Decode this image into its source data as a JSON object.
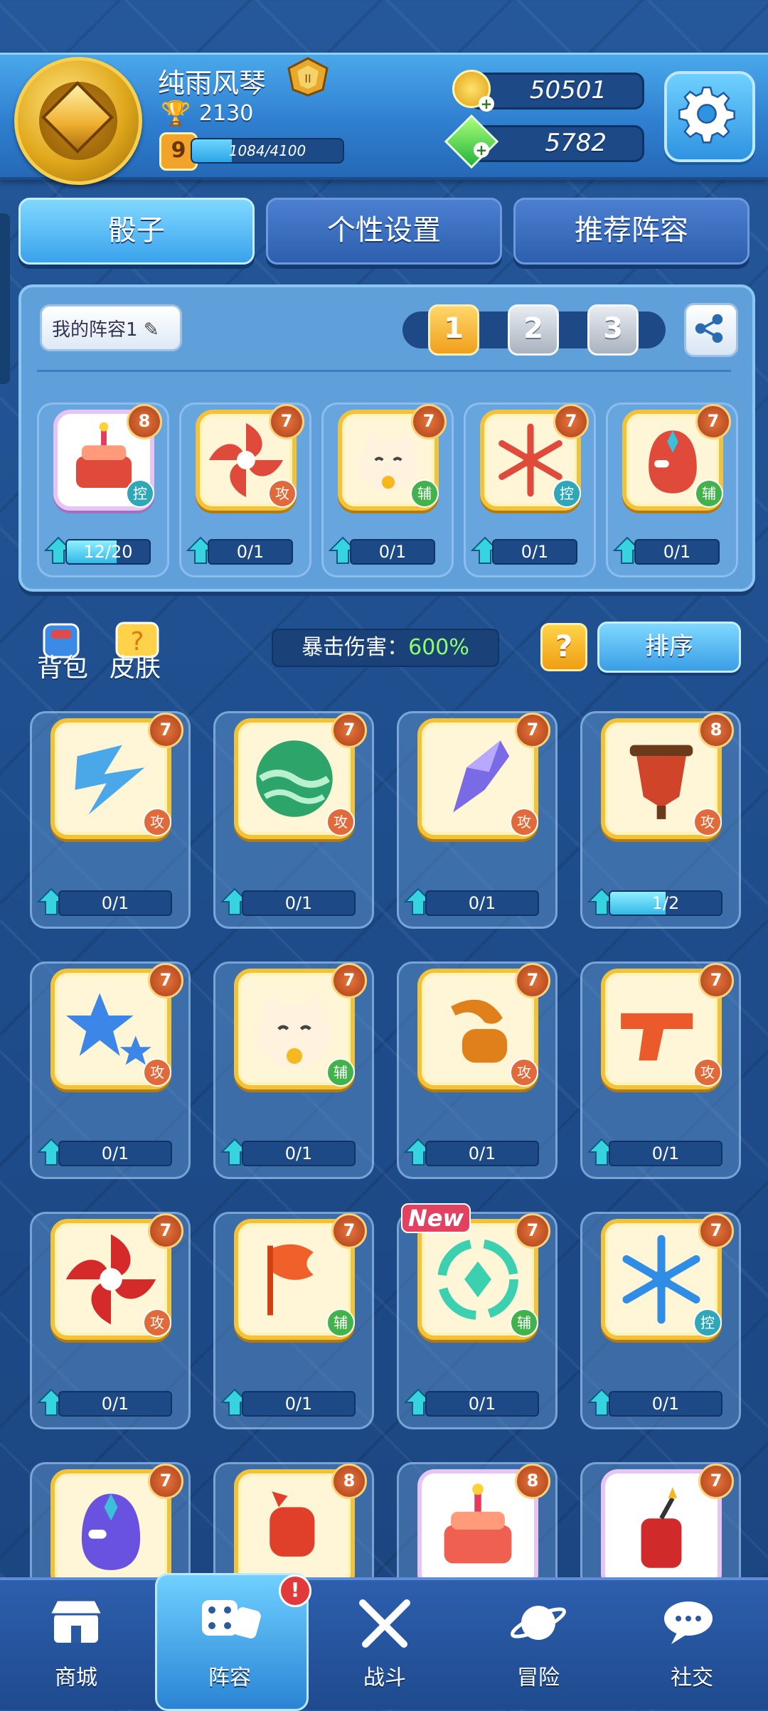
{
  "profile": {
    "name": "纯雨风琴",
    "trophies": "2130",
    "level": "9",
    "xp_text": "1084/4100",
    "xp_fraction": 0.264
  },
  "currency": {
    "gold": "50501",
    "gems": "5782"
  },
  "tabs": [
    "骰子",
    "个性设置",
    "推荐阵容"
  ],
  "loadout": {
    "name": "我的阵容1",
    "slots": [
      "1",
      "2",
      "3"
    ],
    "active_slot": "1",
    "dice": [
      {
        "icon": "cake-icon",
        "level": "8",
        "role": "控",
        "role_type": "ctl",
        "progress": "12/20",
        "fraction": 0.6,
        "frame": "plain"
      },
      {
        "icon": "shuriken-icon",
        "level": "7",
        "role": "攻",
        "role_type": "atk",
        "progress": "0/1",
        "fraction": 0,
        "frame": "gold"
      },
      {
        "icon": "lucky-cat-icon",
        "level": "7",
        "role": "辅",
        "role_type": "sup",
        "progress": "0/1",
        "fraction": 0,
        "frame": "gold"
      },
      {
        "icon": "snowflake-icon",
        "level": "7",
        "role": "控",
        "role_type": "ctl",
        "progress": "0/1",
        "fraction": 0,
        "frame": "gold"
      },
      {
        "icon": "mask-icon",
        "level": "7",
        "role": "辅",
        "role_type": "sup",
        "progress": "0/1",
        "fraction": 0,
        "frame": "gold"
      }
    ]
  },
  "tools": {
    "bag_label": "背包",
    "skin_label": "皮肤",
    "crit_label": "暴击伤害：",
    "crit_value": "600%",
    "help": "?",
    "sort_label": "排序"
  },
  "collection": [
    {
      "icon": "lightning-icon",
      "level": "7",
      "role": "攻",
      "role_type": "atk",
      "progress": "0/1",
      "fraction": 0,
      "color": "#4aa8e8"
    },
    {
      "icon": "green-orb-icon",
      "level": "7",
      "role": "攻",
      "role_type": "atk",
      "progress": "0/1",
      "fraction": 0,
      "color": "#2da56a"
    },
    {
      "icon": "crystal-shard-icon",
      "level": "7",
      "role": "攻",
      "role_type": "atk",
      "progress": "0/1",
      "fraction": 0,
      "color": "#7a6ae6"
    },
    {
      "icon": "shield-icon",
      "level": "8",
      "role": "攻",
      "role_type": "atk",
      "progress": "1/2",
      "fraction": 0.5,
      "color": "#d0442a"
    },
    {
      "icon": "star-icon",
      "level": "7",
      "role": "攻",
      "role_type": "atk",
      "progress": "0/1",
      "fraction": 0,
      "color": "#3c86e8"
    },
    {
      "icon": "lucky-cat-icon",
      "level": "7",
      "role": "辅",
      "role_type": "sup",
      "progress": "0/1",
      "fraction": 0,
      "color": "#f0b848"
    },
    {
      "icon": "sausage-icon",
      "level": "7",
      "role": "攻",
      "role_type": "atk",
      "progress": "0/1",
      "fraction": 0,
      "color": "#e0801a"
    },
    {
      "icon": "pistol-icon",
      "level": "7",
      "role": "攻",
      "role_type": "atk",
      "progress": "0/1",
      "fraction": 0,
      "color": "#ea5a2a"
    },
    {
      "icon": "shuriken-icon",
      "level": "7",
      "role": "攻",
      "role_type": "atk",
      "progress": "0/1",
      "fraction": 0,
      "color": "#d42a2a"
    },
    {
      "icon": "flag-icon",
      "level": "7",
      "role": "辅",
      "role_type": "sup",
      "progress": "0/1",
      "fraction": 0,
      "color": "#f0602a"
    },
    {
      "icon": "swirl-gem-icon",
      "level": "7",
      "role": "辅",
      "role_type": "sup",
      "progress": "0/1",
      "fraction": 0,
      "color": "#3ad0b0",
      "new": "New"
    },
    {
      "icon": "snowflake-icon",
      "level": "7",
      "role": "控",
      "role_type": "ctl",
      "progress": "0/1",
      "fraction": 0,
      "color": "#2f8de6"
    },
    {
      "icon": "mask-icon",
      "level": "7",
      "color": "#6a52e0"
    },
    {
      "icon": "fist-icon",
      "level": "8",
      "color": "#e0402a"
    },
    {
      "icon": "cake-icon",
      "level": "8",
      "color": "#f06050",
      "frame": "plain"
    },
    {
      "icon": "firecracker-icon",
      "level": "7",
      "color": "#d02a2a",
      "frame": "plain"
    }
  ],
  "nav": [
    {
      "icon": "shop-icon",
      "label": "商城"
    },
    {
      "icon": "dice-icon",
      "label": "阵容",
      "badge": "!"
    },
    {
      "icon": "swords-icon",
      "label": "战斗"
    },
    {
      "icon": "planet-icon",
      "label": "冒险"
    },
    {
      "icon": "chat-icon",
      "label": "社交"
    }
  ]
}
